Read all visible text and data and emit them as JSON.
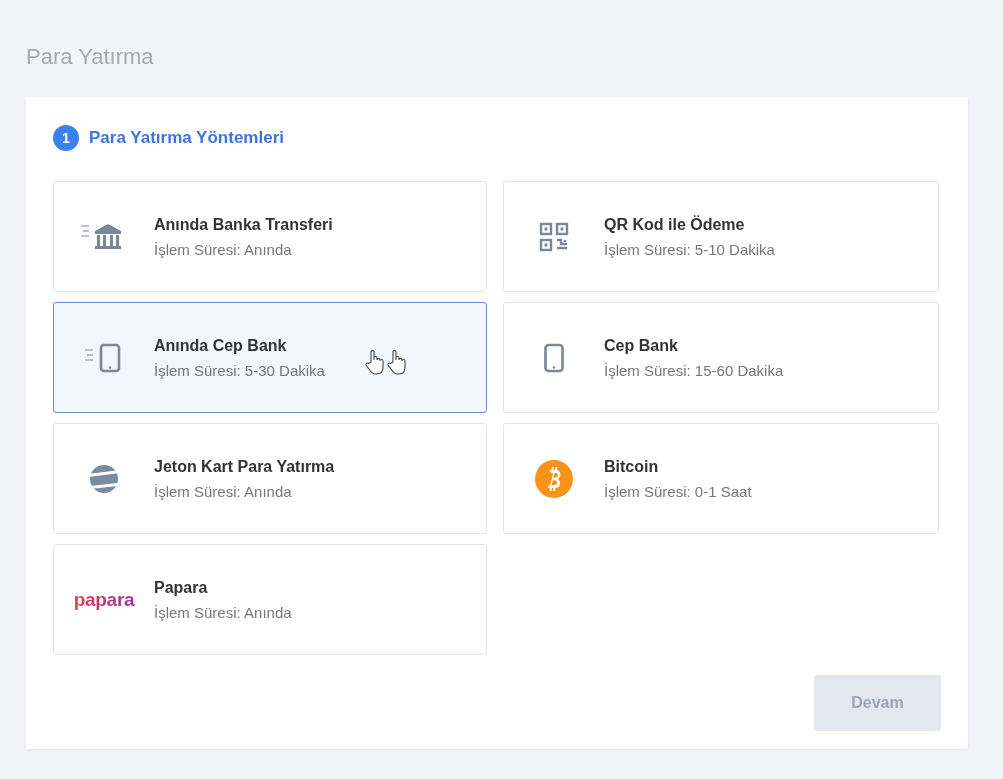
{
  "page_title": "Para Yatırma",
  "panel": {
    "step_number": "1",
    "step_title": "Para Yatırma Yöntemleri",
    "methods": [
      {
        "kind": "bank-fast",
        "name": "Anında Banka Transferi",
        "duration": "İşlem Süresi: Anında",
        "selected": false
      },
      {
        "kind": "qr",
        "name": "QR Kod ile Ödeme",
        "duration": "İşlem Süresi: 5-10 Dakika",
        "selected": false
      },
      {
        "kind": "phone-fast",
        "name": "Anında Cep Bank",
        "duration": "İşlem Süresi: 5-30 Dakika",
        "selected": true
      },
      {
        "kind": "phone",
        "name": "Cep Bank",
        "duration": "İşlem Süresi: 15-60 Dakika",
        "selected": false
      },
      {
        "kind": "jeton",
        "name": "Jeton Kart Para Yatırma",
        "duration": "İşlem Süresi: Anında",
        "selected": false
      },
      {
        "kind": "bitcoin",
        "name": "Bitcoin",
        "duration": "İşlem Süresi: 0-1 Saat",
        "selected": false
      },
      {
        "kind": "wordmark",
        "logo_text": "papara",
        "name": "Papara",
        "duration": "İşlem Süresi: Anında",
        "selected": false
      }
    ],
    "continue_button": {
      "label": "Devam",
      "disabled": true
    }
  }
}
